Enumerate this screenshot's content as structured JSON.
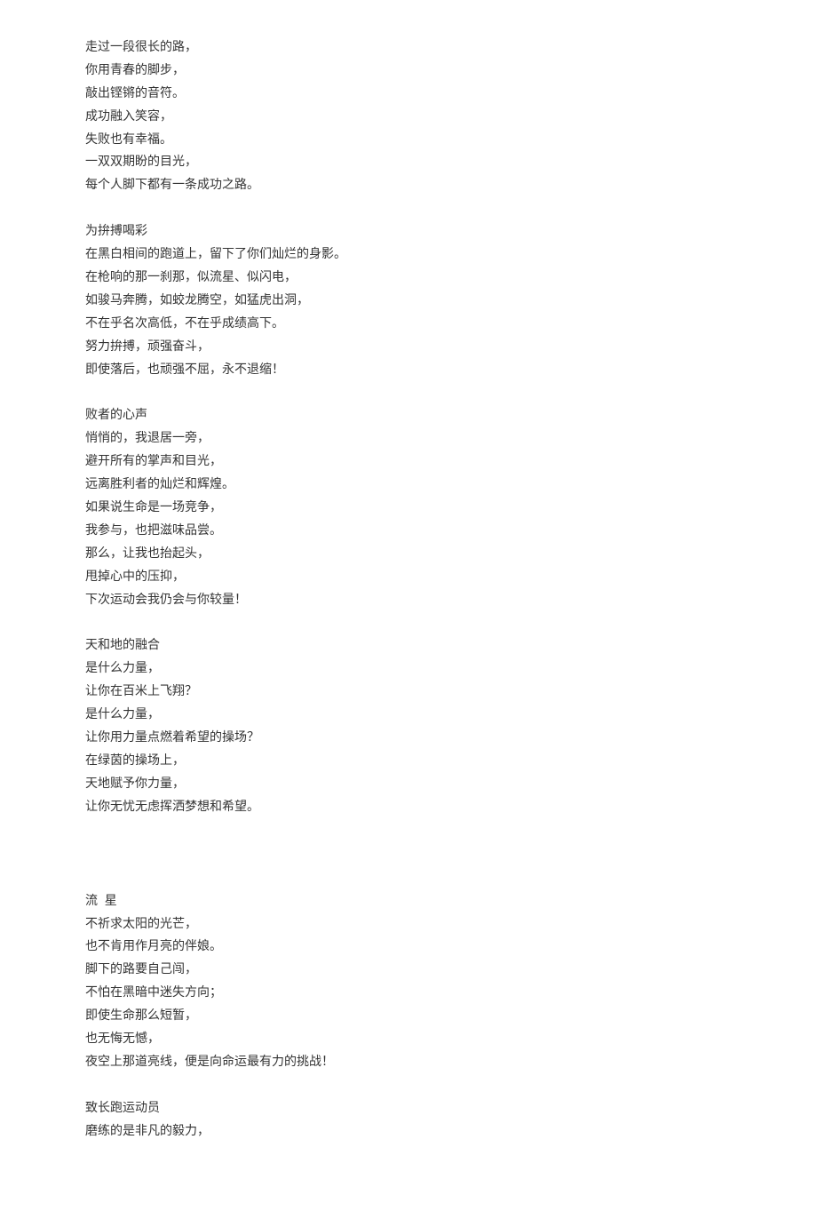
{
  "stanzas": [
    {
      "lines": [
        "走过一段很长的路，",
        "你用青春的脚步，",
        "敲出铿锵的音符。",
        "成功融入笑容，",
        "失败也有幸福。",
        "一双双期盼的目光，",
        "每个人脚下都有一条成功之路。"
      ]
    },
    {
      "lines": [
        "为拚搏喝彩",
        "在黑白相间的跑道上，留下了你们灿烂的身影。",
        "在枪响的那一刹那，似流星、似闪电，",
        "如骏马奔腾，如蛟龙腾空，如猛虎出洞，",
        "不在乎名次高低，不在乎成绩高下。",
        "努力拚搏，顽强奋斗，",
        "即使落后，也顽强不屈，永不退缩！"
      ]
    },
    {
      "lines": [
        "败者的心声",
        "悄悄的，我退居一旁，",
        "避开所有的掌声和目光，",
        "远离胜利者的灿烂和辉煌。",
        "如果说生命是一场竞争，",
        "我参与，也把滋味品尝。",
        "那么，让我也抬起头，",
        "甩掉心中的压抑，",
        "下次运动会我仍会与你较量！"
      ]
    },
    {
      "lines": [
        "天和地的融合",
        "是什么力量，",
        "让你在百米上飞翔？",
        "是什么力量，",
        "让你用力量点燃着希望的操场？",
        "在绿茵的操场上，",
        "天地赋予你力量，",
        "让你无忧无虑挥洒梦想和希望。"
      ]
    },
    {
      "gap_before": true,
      "lines": [
        "流  星",
        "不祈求太阳的光芒，",
        "也不肯用作月亮的伴娘。",
        "脚下的路要自己闯，",
        "不怕在黑暗中迷失方向；",
        "即使生命那么短暂，",
        "也无悔无憾，",
        "夜空上那道亮线，便是向命运最有力的挑战！"
      ]
    },
    {
      "lines": [
        "致长跑运动员",
        "磨练的是非凡的毅力，"
      ]
    }
  ]
}
